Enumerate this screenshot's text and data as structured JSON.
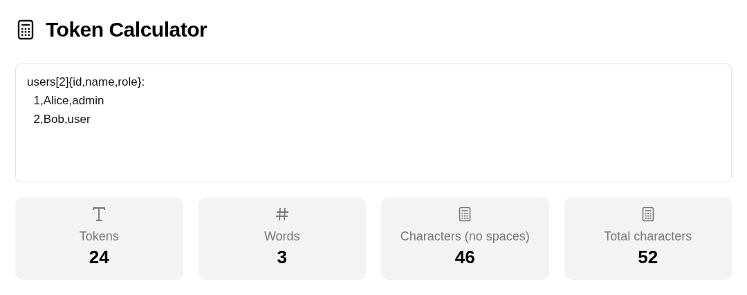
{
  "title": "Token Calculator",
  "input": {
    "value": "users[2]{id,name,role}:\n  1,Alice,admin\n  2,Bob,user"
  },
  "stats": [
    {
      "kind": "tokens",
      "label": "Tokens",
      "value": "24"
    },
    {
      "kind": "words",
      "label": "Words",
      "value": "3"
    },
    {
      "kind": "characters",
      "label": "Characters (no spaces)",
      "value": "46"
    },
    {
      "kind": "characters",
      "label": "Total characters",
      "value": "52"
    }
  ]
}
